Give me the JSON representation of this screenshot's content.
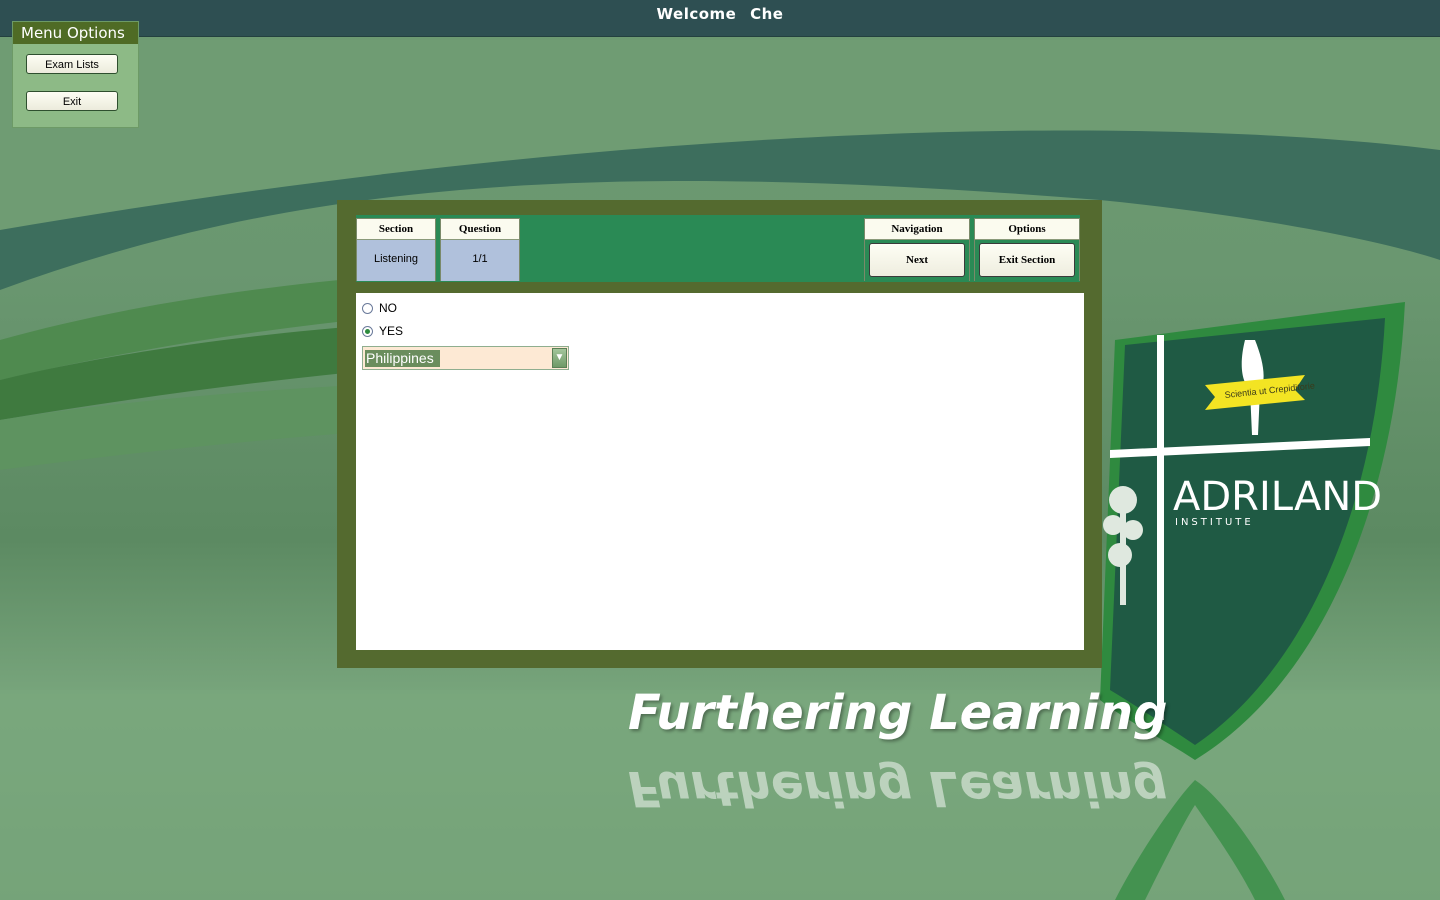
{
  "topbar": {
    "welcome_label": "Welcome",
    "user_name": "Che"
  },
  "menu": {
    "title": "Menu Options",
    "items": [
      {
        "label": "Exam Lists"
      },
      {
        "label": "Exit"
      }
    ]
  },
  "exam": {
    "section_label": "Section",
    "section_value": "Listening",
    "question_label": "Question",
    "question_value": "1/1",
    "navigation_label": "Navigation",
    "next_label": "Next",
    "options_label": "Options",
    "exit_section_label": "Exit Section"
  },
  "answers": {
    "options": [
      {
        "label": "NO",
        "checked": false
      },
      {
        "label": "YES",
        "checked": true
      }
    ],
    "dropdown_value": "Philippines"
  },
  "branding": {
    "tagline": "Furthering Learning",
    "logo_name": "ADRILAND",
    "logo_sub": "INSTITUTE",
    "logo_motto": "Scientia ut Crepiditorie"
  },
  "colors": {
    "topbar": "#2e4f52",
    "menu_title": "#4f6b25",
    "exam_frame": "#546a2f",
    "header_green": "#2a8a55",
    "value_cell": "#b0c1dc",
    "dropdown_bg": "#fde9d4"
  }
}
